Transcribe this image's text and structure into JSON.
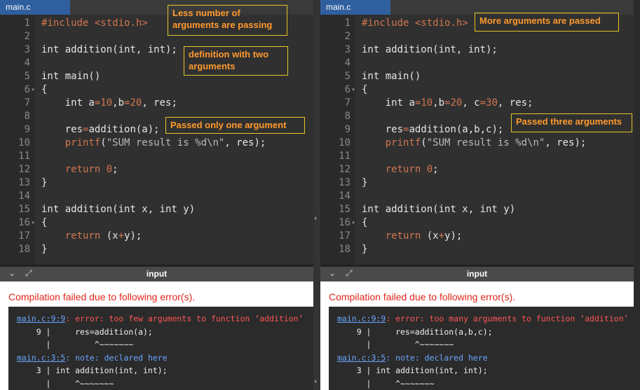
{
  "panels": [
    {
      "tab": "main.c",
      "lines": [
        {
          "n": "1",
          "code": [
            {
              "t": "#include <stdio.h>",
              "c": "pp"
            }
          ]
        },
        {
          "n": "2",
          "code": []
        },
        {
          "n": "3",
          "code": [
            {
              "t": "int addition(int, int);",
              "c": "kw"
            }
          ]
        },
        {
          "n": "4",
          "code": []
        },
        {
          "n": "5",
          "code": [
            {
              "t": "int main()",
              "c": "kw"
            }
          ]
        },
        {
          "n": "6",
          "fold": true,
          "code": [
            {
              "t": "{",
              "c": "kw"
            }
          ]
        },
        {
          "n": "7",
          "code": [
            {
              "t": "    int a",
              "c": "kw"
            },
            {
              "t": "=",
              "c": "fn"
            },
            {
              "t": "10",
              "c": "num"
            },
            {
              "t": ",b",
              "c": "kw"
            },
            {
              "t": "=",
              "c": "fn"
            },
            {
              "t": "20",
              "c": "num"
            },
            {
              "t": ", res;",
              "c": "kw"
            }
          ]
        },
        {
          "n": "8",
          "code": []
        },
        {
          "n": "9",
          "code": [
            {
              "t": "    res",
              "c": "kw"
            },
            {
              "t": "=",
              "c": "fn"
            },
            {
              "t": "addition(a);",
              "c": "kw"
            }
          ]
        },
        {
          "n": "10",
          "code": [
            {
              "t": "    printf",
              "c": "fn"
            },
            {
              "t": "(",
              "c": "kw"
            },
            {
              "t": "\"SUM result is %d\\n\"",
              "c": "str"
            },
            {
              "t": ", res);",
              "c": "kw"
            }
          ]
        },
        {
          "n": "11",
          "code": []
        },
        {
          "n": "12",
          "code": [
            {
              "t": "    return ",
              "c": "fn"
            },
            {
              "t": "0",
              "c": "num"
            },
            {
              "t": ";",
              "c": "kw"
            }
          ]
        },
        {
          "n": "13",
          "code": [
            {
              "t": "}",
              "c": "kw"
            }
          ]
        },
        {
          "n": "14",
          "code": []
        },
        {
          "n": "15",
          "code": [
            {
              "t": "int addition(int x, int y)",
              "c": "kw"
            }
          ]
        },
        {
          "n": "16",
          "fold": true,
          "code": [
            {
              "t": "{",
              "c": "kw"
            }
          ]
        },
        {
          "n": "17",
          "code": [
            {
              "t": "    return ",
              "c": "fn"
            },
            {
              "t": "(x",
              "c": "kw"
            },
            {
              "t": "+",
              "c": "fn"
            },
            {
              "t": "y);",
              "c": "kw"
            }
          ]
        },
        {
          "n": "18",
          "code": [
            {
              "t": "}",
              "c": "kw"
            }
          ]
        }
      ],
      "annotations": [
        {
          "text": "Less number of\narguments are passing"
        },
        {
          "text": "definition with two\narguments"
        },
        {
          "text": "Passed only one argument"
        }
      ],
      "io_title": "input",
      "error_title": "Compilation failed due to following error(s).",
      "console": [
        [
          {
            "t": "main.c:9:9",
            "c": "link"
          },
          {
            "t": ": error: too few arguments to function ‘addition’",
            "c": "e"
          }
        ],
        [
          {
            "t": "    9 |     res=addition(a);",
            "c": ""
          }
        ],
        [
          {
            "t": "      |         ^~~~~~~~",
            "c": ""
          }
        ],
        [
          {
            "t": "main.c:3:5",
            "c": "link"
          },
          {
            "t": ": note: declared here",
            "c": "n"
          }
        ],
        [
          {
            "t": "    3 | int addition(int, int);",
            "c": ""
          }
        ],
        [
          {
            "t": "      |     ^~~~~~~~",
            "c": ""
          }
        ]
      ]
    },
    {
      "tab": "main.c",
      "lines": [
        {
          "n": "1",
          "code": [
            {
              "t": "#include <stdio.h>",
              "c": "pp"
            }
          ]
        },
        {
          "n": "2",
          "code": []
        },
        {
          "n": "3",
          "code": [
            {
              "t": "int addition(int, int);",
              "c": "kw"
            }
          ]
        },
        {
          "n": "4",
          "code": []
        },
        {
          "n": "5",
          "code": [
            {
              "t": "int main()",
              "c": "kw"
            }
          ]
        },
        {
          "n": "6",
          "fold": true,
          "code": [
            {
              "t": "{",
              "c": "kw"
            }
          ]
        },
        {
          "n": "7",
          "code": [
            {
              "t": "    int a",
              "c": "kw"
            },
            {
              "t": "=",
              "c": "fn"
            },
            {
              "t": "10",
              "c": "num"
            },
            {
              "t": ",b",
              "c": "kw"
            },
            {
              "t": "=",
              "c": "fn"
            },
            {
              "t": "20",
              "c": "num"
            },
            {
              "t": ", c",
              "c": "kw"
            },
            {
              "t": "=",
              "c": "fn"
            },
            {
              "t": "30",
              "c": "num"
            },
            {
              "t": ", res;",
              "c": "kw"
            }
          ]
        },
        {
          "n": "8",
          "code": []
        },
        {
          "n": "9",
          "code": [
            {
              "t": "    res",
              "c": "kw"
            },
            {
              "t": "=",
              "c": "fn"
            },
            {
              "t": "addition(a,b,c);",
              "c": "kw"
            }
          ]
        },
        {
          "n": "10",
          "code": [
            {
              "t": "    printf",
              "c": "fn"
            },
            {
              "t": "(",
              "c": "kw"
            },
            {
              "t": "\"SUM result is %d\\n\"",
              "c": "str"
            },
            {
              "t": ", res);",
              "c": "kw"
            }
          ]
        },
        {
          "n": "11",
          "code": []
        },
        {
          "n": "12",
          "code": [
            {
              "t": "    return ",
              "c": "fn"
            },
            {
              "t": "0",
              "c": "num"
            },
            {
              "t": ";",
              "c": "kw"
            }
          ]
        },
        {
          "n": "13",
          "code": [
            {
              "t": "}",
              "c": "kw"
            }
          ]
        },
        {
          "n": "14",
          "code": []
        },
        {
          "n": "15",
          "code": [
            {
              "t": "int addition(int x, int y)",
              "c": "kw"
            }
          ]
        },
        {
          "n": "16",
          "fold": true,
          "code": [
            {
              "t": "{",
              "c": "kw"
            }
          ]
        },
        {
          "n": "17",
          "code": [
            {
              "t": "    return ",
              "c": "fn"
            },
            {
              "t": "(x",
              "c": "kw"
            },
            {
              "t": "+",
              "c": "fn"
            },
            {
              "t": "y);",
              "c": "kw"
            }
          ]
        },
        {
          "n": "18",
          "code": [
            {
              "t": "}",
              "c": "kw"
            }
          ]
        }
      ],
      "annotations": [
        {
          "text": "More arguments are passed"
        },
        {
          "text": "Passed three arguments"
        }
      ],
      "io_title": "input",
      "error_title": "Compilation failed due to following error(s).",
      "console": [
        [
          {
            "t": "main.c:9:9",
            "c": "link"
          },
          {
            "t": ": error: too many arguments to function ‘addition’",
            "c": "e"
          }
        ],
        [
          {
            "t": "    9 |     res=addition(a,b,c);",
            "c": ""
          }
        ],
        [
          {
            "t": "      |         ^~~~~~~~",
            "c": ""
          }
        ],
        [
          {
            "t": "main.c:3:5",
            "c": "link"
          },
          {
            "t": ": note: declared here",
            "c": "n"
          }
        ],
        [
          {
            "t": "    3 | int addition(int, int);",
            "c": ""
          }
        ],
        [
          {
            "t": "      |     ^~~~~~~~",
            "c": ""
          }
        ]
      ]
    }
  ],
  "icons": {
    "collapse": "chevron-down-icon",
    "expand": "expand-arrows-icon",
    "fold": "fold-arrow-icon"
  },
  "colors": {
    "tab": "#2f5f9e",
    "annotation_border": "#e6c52a",
    "annotation_text": "#ff9a2e",
    "error": "#e0251b"
  }
}
